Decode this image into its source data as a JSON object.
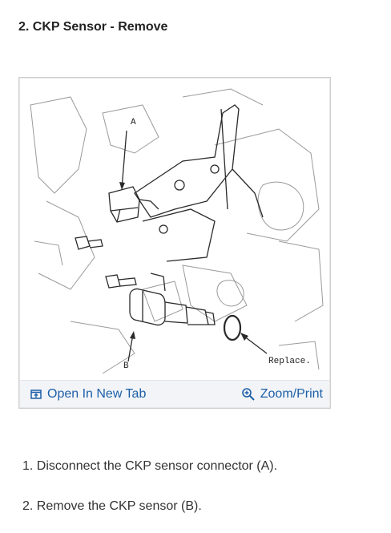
{
  "heading": "2. CKP Sensor - Remove",
  "figure": {
    "callouts": {
      "a": "A",
      "b": "B",
      "replace": "Replace."
    },
    "toolbar": {
      "open_tab_label": "Open In New Tab",
      "zoom_label": "Zoom/Print"
    },
    "accent_color": "#1d5fa8"
  },
  "steps": [
    "1. Disconnect the CKP sensor connector (A).",
    "2. Remove the CKP sensor (B)."
  ]
}
